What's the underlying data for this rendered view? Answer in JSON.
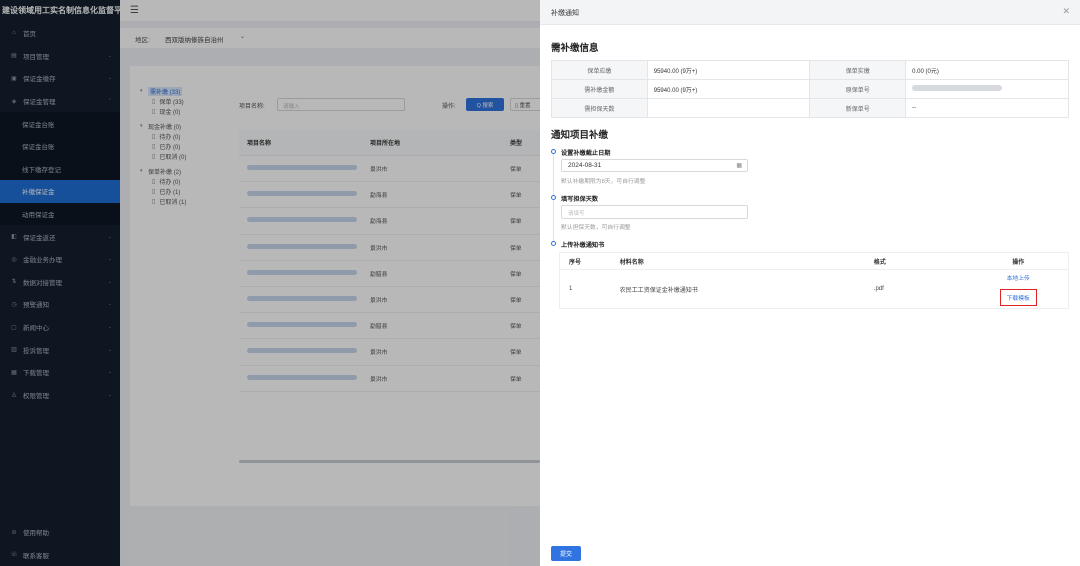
{
  "app": {
    "title": "建设领域用工实名制信息化监督平台"
  },
  "sidebar": {
    "items": [
      {
        "label": "首页",
        "icon": "home-icon",
        "glyph": "⌂",
        "chevron": false
      },
      {
        "label": "项目管理",
        "icon": "project-icon",
        "glyph": "▤",
        "chevron": true
      },
      {
        "label": "保证金缴存",
        "icon": "deposit-icon",
        "glyph": "▣",
        "chevron": true
      },
      {
        "label": "保证金管理",
        "icon": "manage-icon",
        "glyph": "◈",
        "chevron": true,
        "expanded": true
      }
    ],
    "sub_items": [
      {
        "label": "保证金台账",
        "active": false
      },
      {
        "label": "保证金台账",
        "active": false
      },
      {
        "label": "线下缴存登记",
        "active": false
      },
      {
        "label": "补缴保证金",
        "active": true
      },
      {
        "label": "动用保证金",
        "active": false
      }
    ],
    "items2": [
      {
        "label": "保证金返还",
        "icon": "refund-icon",
        "glyph": "◧"
      },
      {
        "label": "金融业务办理",
        "icon": "finance-icon",
        "glyph": "◎"
      },
      {
        "label": "数据对接管理",
        "icon": "data-icon",
        "glyph": "⇅"
      },
      {
        "label": "预警通知",
        "icon": "alert-icon",
        "glyph": "◷"
      },
      {
        "label": "新闻中心",
        "icon": "news-icon",
        "glyph": "▢"
      },
      {
        "label": "投诉管理",
        "icon": "complaint-icon",
        "glyph": "▥"
      },
      {
        "label": "下载管理",
        "icon": "download-icon",
        "glyph": "▦"
      },
      {
        "label": "权限管理",
        "icon": "permission-icon",
        "glyph": "◬"
      }
    ],
    "bottom": [
      {
        "label": "使用帮助",
        "icon": "help-icon",
        "glyph": "⊘"
      },
      {
        "label": "联系客服",
        "icon": "service-icon",
        "glyph": "☏"
      }
    ]
  },
  "filter": {
    "label": "地区:",
    "value": "西双版纳傣族自治州"
  },
  "tree": [
    {
      "label": "需补缴 (33)",
      "highlight": true,
      "children": [
        "保单 (33)",
        "现金 (0)"
      ]
    },
    {
      "label": "现金补缴 (0)",
      "highlight": false,
      "children": [
        "待办 (0)",
        "已办 (0)",
        "已取消 (0)"
      ]
    },
    {
      "label": "保单补缴 (2)",
      "highlight": false,
      "children": [
        "待办 (0)",
        "已办 (1)",
        "已取消 (1)"
      ]
    }
  ],
  "search": {
    "label": "项目名称:",
    "placeholder": "请输入",
    "ops_label": "操作:",
    "search_btn": "Q 搜索",
    "reset_btn": "▯ 重置"
  },
  "project_table": {
    "headers": [
      "项目名称",
      "项目所在地",
      "类型"
    ],
    "rows": [
      {
        "location": "景洪市",
        "type": "保单"
      },
      {
        "location": "勐海县",
        "type": "保单"
      },
      {
        "location": "勐海县",
        "type": "保单"
      },
      {
        "location": "景洪市",
        "type": "保单"
      },
      {
        "location": "勐腊县",
        "type": "保单"
      },
      {
        "location": "景洪市",
        "type": "保单"
      },
      {
        "location": "勐腊县",
        "type": "保单"
      },
      {
        "location": "景洪市",
        "type": "保单"
      },
      {
        "location": "景洪市",
        "type": "保单"
      }
    ]
  },
  "drawer": {
    "title": "补缴通知",
    "info_title": "需补缴信息",
    "info": [
      [
        "保单应缴",
        "95940.00 (9万+)",
        "保单实缴",
        "0.00 (0元)"
      ],
      [
        "需补缴金额",
        "95940.00 (9万+)",
        "原保单号",
        ""
      ],
      [
        "需担保天数",
        "",
        "新保单号",
        "--"
      ]
    ],
    "notify_title": "通知项目补缴",
    "step1": {
      "title": "设置补缴截止日期",
      "date": "2024-08-31",
      "hint": "默认补缴期限为8天，可自行调整"
    },
    "step2": {
      "title": "填写担保天数",
      "placeholder": "请填写",
      "hint": "默认担保天数，可自行调整"
    },
    "step3": {
      "title": "上传补缴通知书"
    },
    "materials": {
      "headers": [
        "序号",
        "材料名称",
        "格式",
        "操作"
      ],
      "rows": [
        {
          "no": "1",
          "name": "农民工工资保证金补缴通知书",
          "format": ".pdf",
          "upload": "本地上传",
          "download": "下载模板"
        }
      ]
    },
    "submit": "提交"
  }
}
